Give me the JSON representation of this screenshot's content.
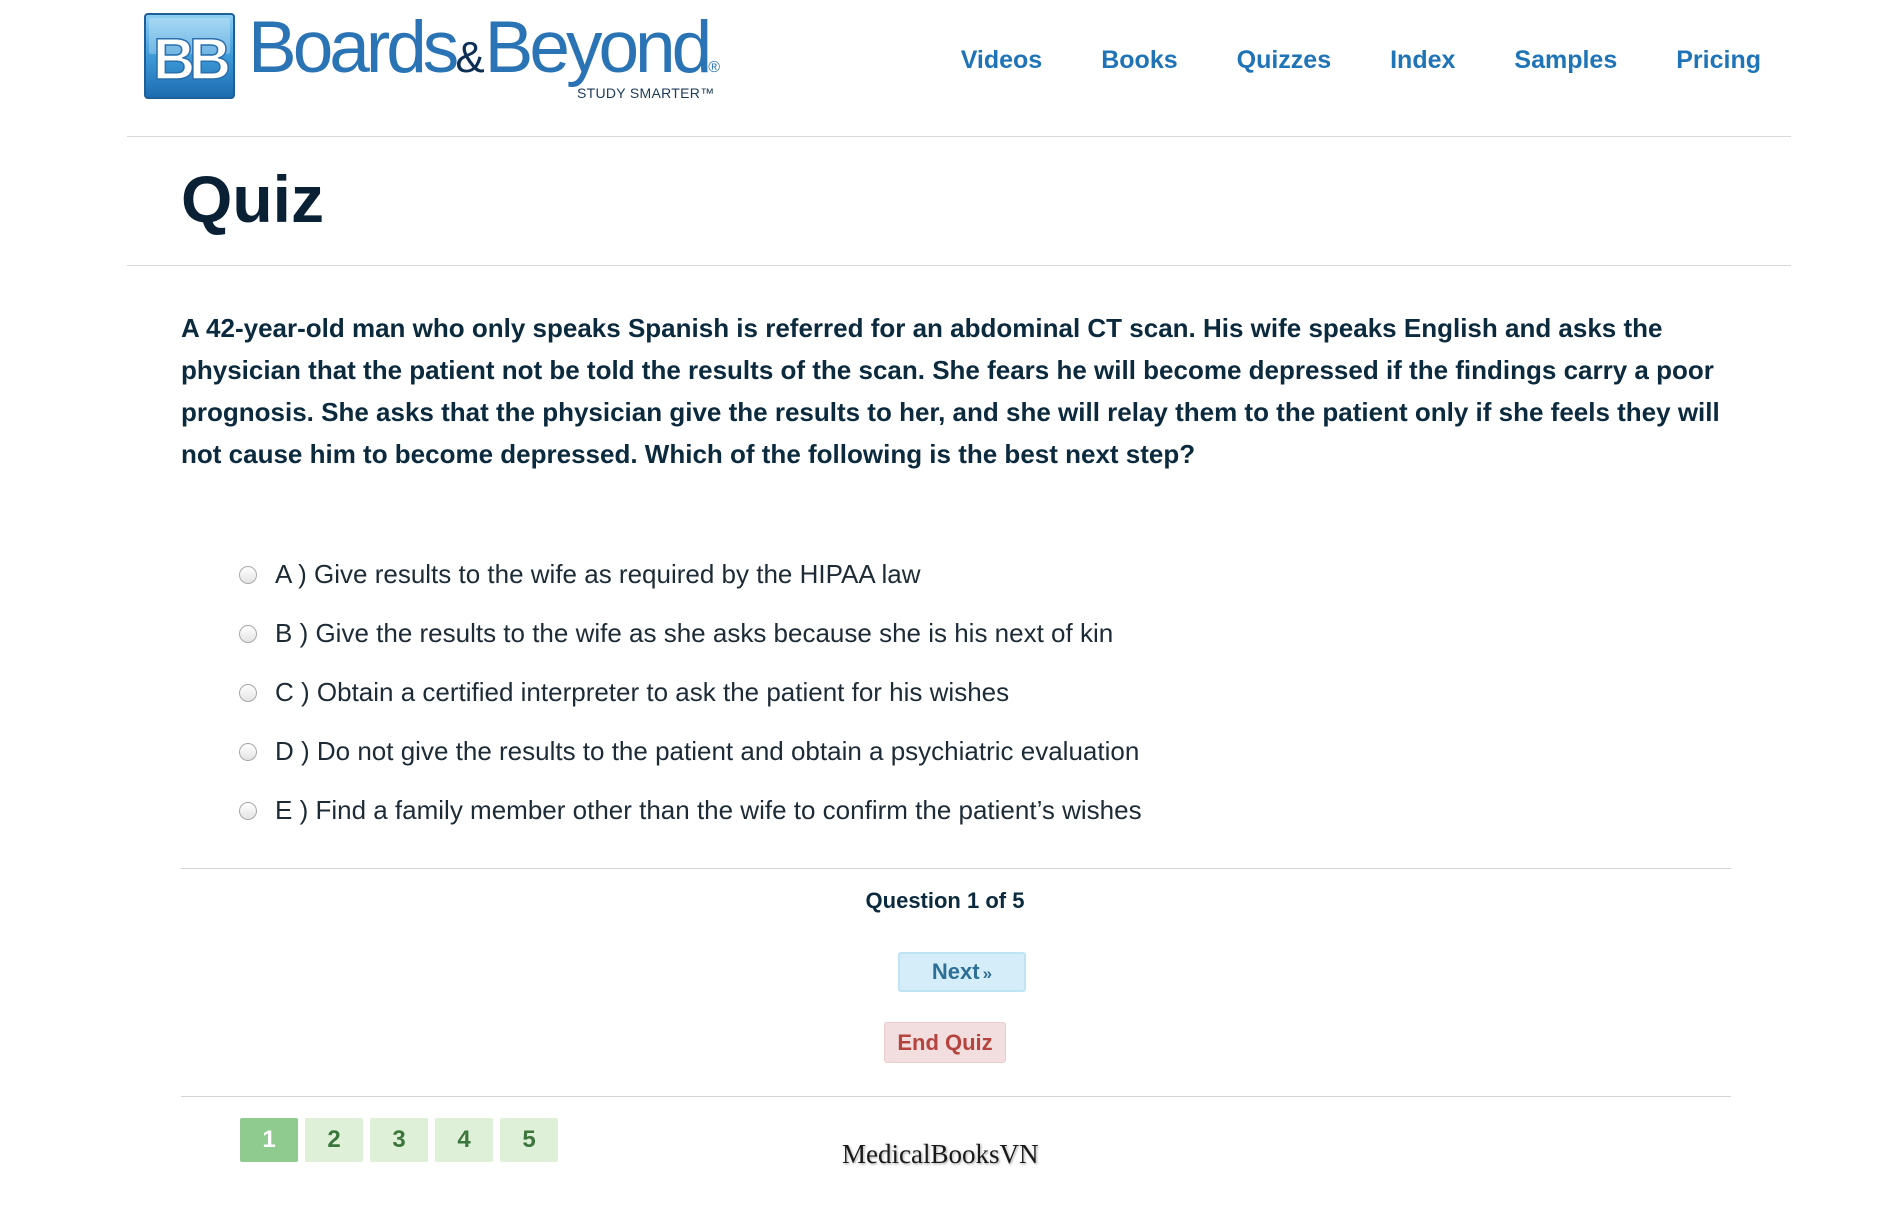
{
  "header": {
    "logo": {
      "badge_text": "BB",
      "wordmark_1": "Boards",
      "wordmark_amp": "&",
      "wordmark_2": "Beyond",
      "registered": "®",
      "tagline": "STUDY SMARTER™"
    },
    "nav": [
      {
        "label": "Videos"
      },
      {
        "label": "Books"
      },
      {
        "label": "Quizzes"
      },
      {
        "label": "Index"
      },
      {
        "label": "Samples"
      },
      {
        "label": "Pricing"
      }
    ]
  },
  "page": {
    "title": "Quiz"
  },
  "quiz": {
    "question": "A 42-year-old man who only speaks Spanish is referred for an abdominal CT scan. His wife speaks English and asks the physician that the patient not be told the results of the scan. She fears he will become depressed if the findings carry a poor prognosis. She asks that the physician give the results to her, and she will relay them to the patient only if she feels they will not cause him to become depressed. Which of the following is the best next step?",
    "options": [
      {
        "letter": "A",
        "text": "A ) Give results to the wife as required by the HIPAA law",
        "selected": false
      },
      {
        "letter": "B",
        "text": "B ) Give the results to the wife as she asks because she is his next of kin",
        "selected": false
      },
      {
        "letter": "C",
        "text": "C ) Obtain a certified interpreter to ask the patient for his wishes",
        "selected": false
      },
      {
        "letter": "D",
        "text": "D ) Do not give the results to the patient and obtain a psychiatric evaluation",
        "selected": false
      },
      {
        "letter": "E",
        "text": "E ) Find a family member other than the wife to confirm the patient’s wishes",
        "selected": false
      }
    ],
    "progress_text": "Question 1 of 5",
    "current_question": 1,
    "total_questions": 5,
    "next_label": "Next",
    "next_arrows": "»",
    "end_label": "End Quiz",
    "pages": [
      {
        "label": "1",
        "active": true
      },
      {
        "label": "2",
        "active": false
      },
      {
        "label": "3",
        "active": false
      },
      {
        "label": "4",
        "active": false
      },
      {
        "label": "5",
        "active": false
      }
    ]
  },
  "watermark": "MedicalBooksVN",
  "colors": {
    "brand_blue": "#2a73b4",
    "nav_blue": "#1f73b7",
    "heading_navy": "#0a2135",
    "next_bg": "#d5edf8",
    "end_bg": "#f2dede",
    "end_text": "#b5443f",
    "page_bg": "#dff0d8",
    "page_active_bg": "#8fcb8f",
    "page_text": "#3c763d"
  }
}
